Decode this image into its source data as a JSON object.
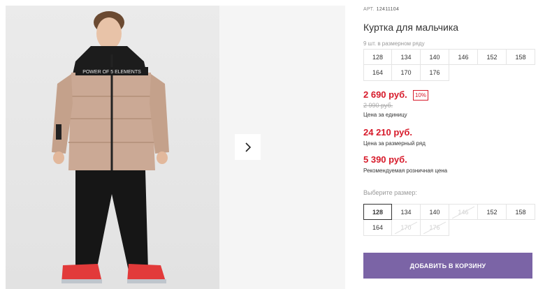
{
  "product": {
    "art_label": "АРТ.",
    "art_number": "12411104",
    "title": "Куртка для мальчика",
    "photo_print_text": "POWER OF 5 ELEMENTS"
  },
  "pack": {
    "note": "9 шт. в размерном ряду",
    "sizes": [
      "128",
      "134",
      "140",
      "146",
      "152",
      "158",
      "164",
      "170",
      "176"
    ]
  },
  "prices": {
    "unit_price": "2 690 руб.",
    "discount": "10%",
    "old_price": "2 990 руб.",
    "unit_caption": "Цена за единицу",
    "pack_price": "24 210 руб.",
    "pack_caption": "Цена за размерный ряд",
    "retail_price": "5 390 руб.",
    "retail_caption": "Рекомендуемая розничная цена"
  },
  "size_picker": {
    "label": "Выберите размер:",
    "sizes": [
      {
        "value": "128",
        "state": "selected"
      },
      {
        "value": "134",
        "state": "available"
      },
      {
        "value": "140",
        "state": "available"
      },
      {
        "value": "146",
        "state": "disabled"
      },
      {
        "value": "152",
        "state": "available"
      },
      {
        "value": "158",
        "state": "available"
      },
      {
        "value": "164",
        "state": "available"
      },
      {
        "value": "170",
        "state": "disabled"
      },
      {
        "value": "176",
        "state": "disabled"
      }
    ]
  },
  "cart_button": {
    "label": "ДОБАВИТЬ В КОРЗИНУ"
  },
  "icons": {
    "next": "chevron-right-icon"
  },
  "colors": {
    "price_red": "#d71a2a",
    "button_purple": "#7b64a6"
  }
}
